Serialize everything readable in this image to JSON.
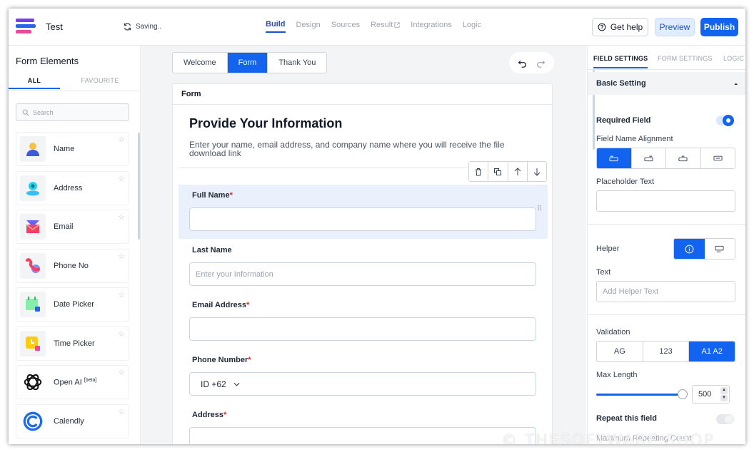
{
  "header": {
    "form_name": "Test",
    "status": "Saving..",
    "nav": [
      {
        "label": "Build",
        "active": true
      },
      {
        "label": "Design",
        "active": false
      },
      {
        "label": "Sources",
        "active": false
      },
      {
        "label": "Result",
        "active": false,
        "icon": "external-link-icon"
      },
      {
        "label": "Integrations",
        "active": false
      },
      {
        "label": "Logic",
        "active": false
      }
    ],
    "help_label": "Get help",
    "preview_label": "Preview",
    "publish_label": "Publish"
  },
  "sidebar": {
    "title": "Form Elements",
    "tabs": [
      "ALL",
      "FAVOURITE"
    ],
    "search_placeholder": "Search",
    "elements": [
      {
        "label": "Name",
        "icon": "person-icon"
      },
      {
        "label": "Address",
        "icon": "location-pin-icon"
      },
      {
        "label": "Email",
        "icon": "envelope-icon"
      },
      {
        "label": "Phone No",
        "icon": "phone-icon"
      },
      {
        "label": "Date Picker",
        "icon": "calendar-icon"
      },
      {
        "label": "Time Picker",
        "icon": "clock-icon"
      },
      {
        "label": "Open AI",
        "badge": "[beta]",
        "icon": "openai-logo-icon"
      },
      {
        "label": "Calendly",
        "icon": "calendly-logo-icon"
      }
    ]
  },
  "canvas": {
    "steps": [
      {
        "label": "Welcome",
        "active": false
      },
      {
        "label": "Form",
        "active": true
      },
      {
        "label": "Thank You",
        "active": false
      }
    ],
    "card_title": "Form",
    "form_title": "Provide Your Information",
    "form_description": "Enter your name, email address, and company name where you will receive the file download link",
    "fields": [
      {
        "label": "Full Name",
        "required": true,
        "placeholder": "",
        "selected": true
      },
      {
        "label": "Last Name",
        "required": false,
        "placeholder": "Enter your Information"
      },
      {
        "label": "Email Address",
        "required": true,
        "placeholder": ""
      },
      {
        "label": "Phone Number",
        "required": true,
        "prefix": "ID +62"
      },
      {
        "label": "Address",
        "required": true,
        "placeholder": ""
      }
    ]
  },
  "settings": {
    "tabs": [
      "FIELD SETTINGS",
      "FORM SETTINGS",
      "LOGIC"
    ],
    "section": "Basic Setting",
    "required_label": "Required Field",
    "required_on": true,
    "alignment_label": "Field Name Alignment",
    "placeholder_label": "Placeholder Text",
    "placeholder_value": "",
    "helper_label": "Helper",
    "text_label": "Text",
    "helper_placeholder": "Add Helper Text",
    "validation_label": "Validation",
    "validation_options": [
      "AG",
      "123",
      "A1 A2"
    ],
    "validation_active": 2,
    "max_length_label": "Max Length",
    "max_length_value": "500",
    "max_length_level": 0.97,
    "repeat_label": "Repeat this field",
    "repeat_on": false,
    "next_label": "Maximum Repeating Count"
  },
  "watermark": "© THESOFTWARE.SHOP",
  "colors": {
    "accent": "#1264f0",
    "required": "#dc2626",
    "selected_bg": "#eaf1fd"
  }
}
